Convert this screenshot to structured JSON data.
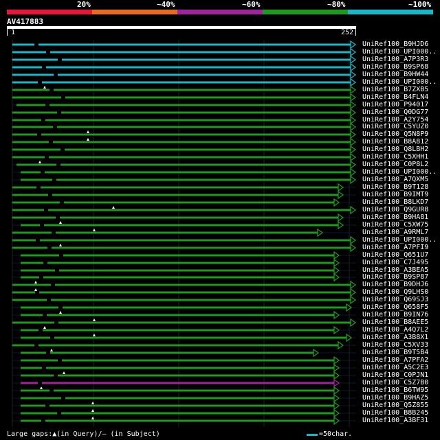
{
  "legend": {
    "labels": [
      "20%",
      "~40%",
      "~60%",
      "~80%",
      "~100%"
    ],
    "colors": [
      "#e8173a",
      "#e86b1f",
      "#a0249c",
      "#1e9a1e",
      "#1ab7c8"
    ]
  },
  "query": {
    "name": "AV417883",
    "start": "1",
    "end": "252"
  },
  "hits": [
    {
      "label": "UniRef100_B9HJD6",
      "color": "#1ab7c8"
    },
    {
      "label": "UniRef100_UPI000..",
      "color": "#1ab7c8"
    },
    {
      "label": "UniRef100_A7P3R3",
      "color": "#1ab7c8"
    },
    {
      "label": "UniRef100_B9SP68",
      "color": "#1ab7c8"
    },
    {
      "label": "UniRef100_B9HW44",
      "color": "#1ab7c8"
    },
    {
      "label": "UniRef100_UPI000..",
      "color": "#1ab7c8"
    },
    {
      "label": "UniRef100_B7ZXB5",
      "color": "#1e9a1e"
    },
    {
      "label": "UniRef100_B4FLN4",
      "color": "#1e9a1e"
    },
    {
      "label": "UniRef100_P94017",
      "color": "#1e9a1e"
    },
    {
      "label": "UniRef100_Q0DG77",
      "color": "#1e9a1e"
    },
    {
      "label": "UniRef100_A2Y754",
      "color": "#1e9a1e"
    },
    {
      "label": "UniRef100_C5YUZ0",
      "color": "#1e9a1e"
    },
    {
      "label": "UniRef100_Q5N8P9",
      "color": "#1e9a1e"
    },
    {
      "label": "UniRef100_B8A812",
      "color": "#1e9a1e"
    },
    {
      "label": "UniRef100_Q8LBH2",
      "color": "#1e9a1e"
    },
    {
      "label": "UniRef100_C5XHH1",
      "color": "#1e9a1e"
    },
    {
      "label": "UniRef100_C0P8L2",
      "color": "#1e9a1e"
    },
    {
      "label": "UniRef100_UPI000..",
      "color": "#1e9a1e"
    },
    {
      "label": "UniRef100_A7QXM5",
      "color": "#1e9a1e"
    },
    {
      "label": "UniRef100_B9T128",
      "color": "#1e9a1e"
    },
    {
      "label": "UniRef100_B9IMT9",
      "color": "#1e9a1e"
    },
    {
      "label": "UniRef100_B8LKD7",
      "color": "#1e9a1e"
    },
    {
      "label": "UniRef100_Q9GUR8",
      "color": "#1e9a1e"
    },
    {
      "label": "UniRef100_B9HA81",
      "color": "#1e9a1e"
    },
    {
      "label": "UniRef100_C5XW75",
      "color": "#1e9a1e"
    },
    {
      "label": "UniRef100_A9RML7",
      "color": "#1e9a1e"
    },
    {
      "label": "UniRef100_UPI000..",
      "color": "#1e9a1e"
    },
    {
      "label": "UniRef100_A7PFI9",
      "color": "#1e9a1e"
    },
    {
      "label": "UniRef100_Q651U7",
      "color": "#1e9a1e"
    },
    {
      "label": "UniRef100_C7J495",
      "color": "#1e9a1e"
    },
    {
      "label": "UniRef100_A3BEA5",
      "color": "#1e9a1e"
    },
    {
      "label": "UniRef100_B9SP87",
      "color": "#1e9a1e"
    },
    {
      "label": "UniRef100_B9DHJ6",
      "color": "#1e9a1e"
    },
    {
      "label": "UniRef100_Q9LHS0",
      "color": "#1e9a1e"
    },
    {
      "label": "UniRef100_Q69SJ3",
      "color": "#1e9a1e"
    },
    {
      "label": "UniRef100_Q658F5",
      "color": "#1e9a1e"
    },
    {
      "label": "UniRef100_B9IN76",
      "color": "#1e9a1e"
    },
    {
      "label": "UniRef100_B8AEE5",
      "color": "#1e9a1e"
    },
    {
      "label": "UniRef100_A4Q7L2",
      "color": "#1e9a1e"
    },
    {
      "label": "UniRef100_A3B8X1",
      "color": "#1e9a1e"
    },
    {
      "label": "UniRef100_C5XV33",
      "color": "#1e9a1e"
    },
    {
      "label": "UniRef100_B9T5B4",
      "color": "#1e9a1e"
    },
    {
      "label": "UniRef100_A7PFA2",
      "color": "#1e9a1e"
    },
    {
      "label": "UniRef100_A5C2E3",
      "color": "#1e9a1e"
    },
    {
      "label": "UniRef100_C0PJN1",
      "color": "#1e9a1e"
    },
    {
      "label": "UniRef100_C5Z7B0",
      "color": "#a0249c"
    },
    {
      "label": "UniRef100_B6TW95",
      "color": "#1e9a1e"
    },
    {
      "label": "UniRef100_B9HAZ5",
      "color": "#1e9a1e"
    },
    {
      "label": "UniRef100_Q5Z855",
      "color": "#1e9a1e"
    },
    {
      "label": "UniRef100_B8B245",
      "color": "#1e9a1e"
    },
    {
      "label": "UniRef100_A3BF31",
      "color": "#1e9a1e"
    }
  ],
  "footer": {
    "gaps_text": "Large gaps:▲(in Query)/— (in Subject)",
    "scale_text": "=50char."
  }
}
